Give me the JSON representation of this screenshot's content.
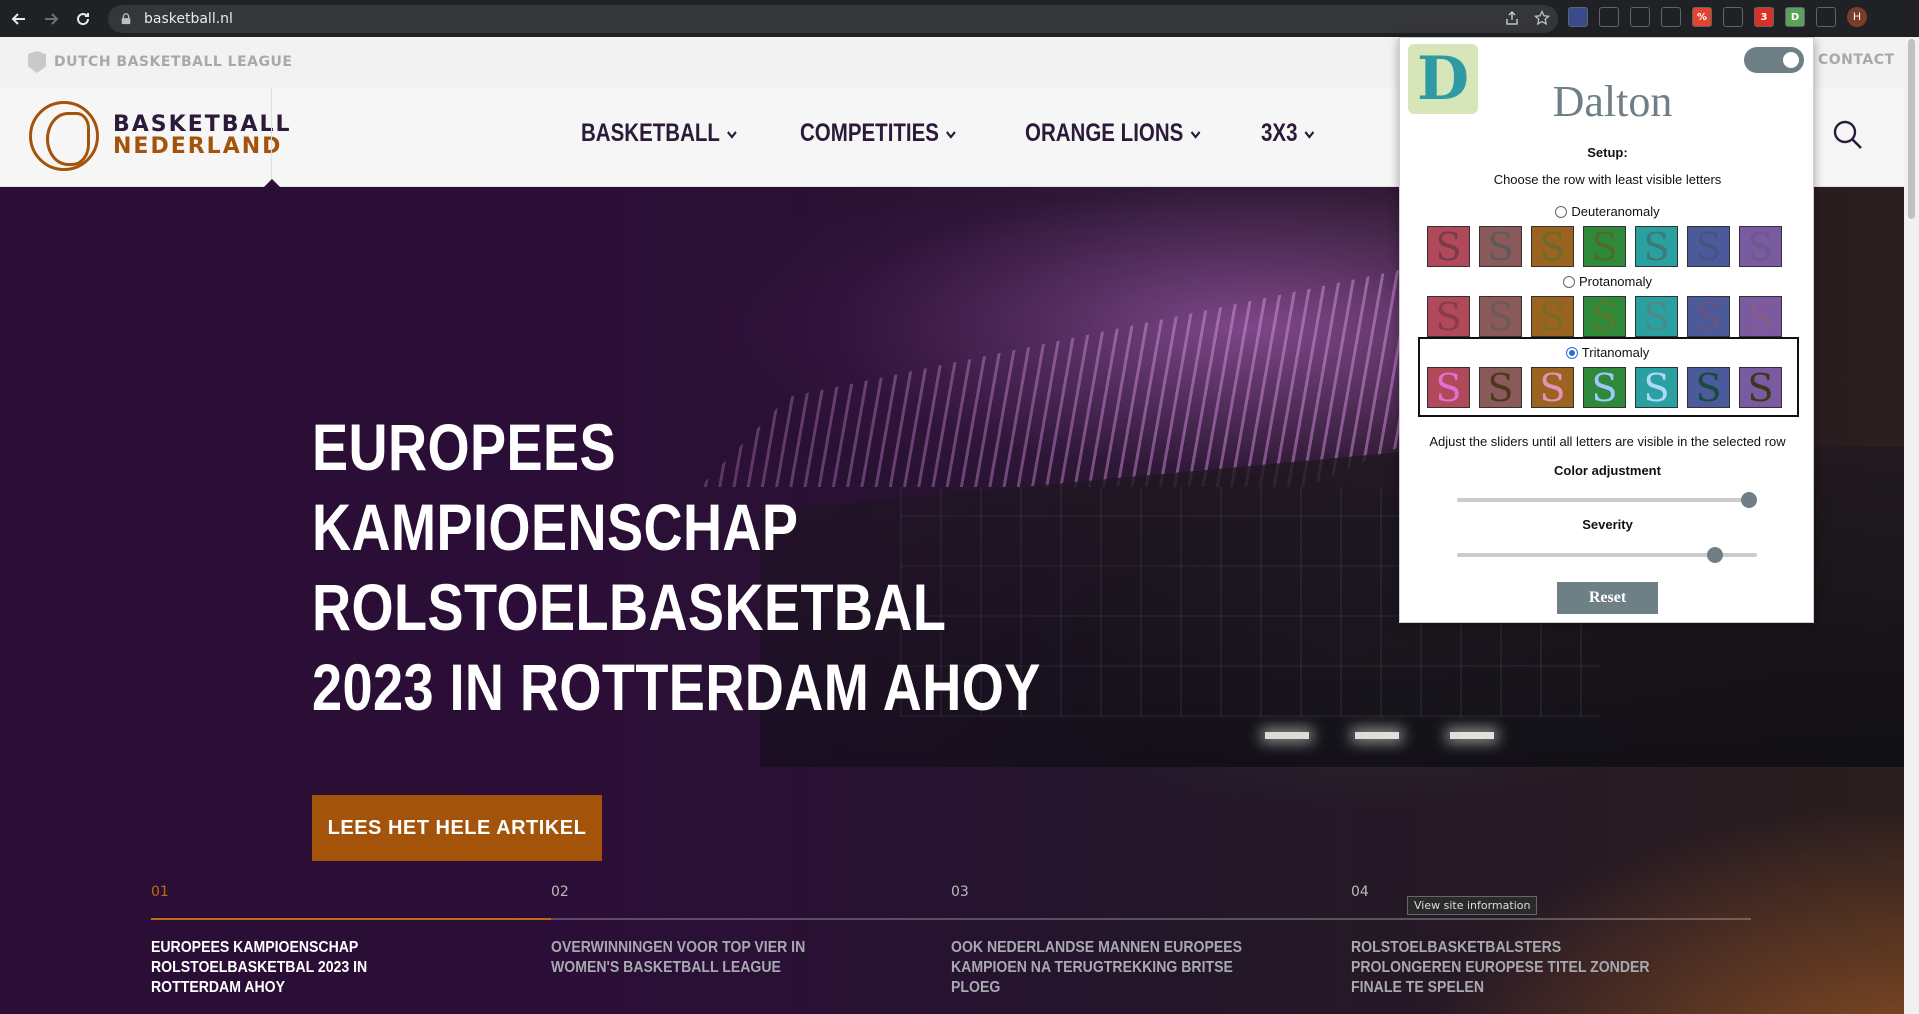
{
  "browser": {
    "url": "basketball.nl",
    "profile_initial": "H",
    "extensions": [
      {
        "name": "pen-extension-icon",
        "color": "#3a4b8c",
        "label": ""
      },
      {
        "name": "bars-extension-icon",
        "color": "#202124",
        "label": ""
      },
      {
        "name": "image-extension-icon",
        "color": "#202124",
        "label": ""
      },
      {
        "name": "v-extension-icon",
        "color": "#202124",
        "label": ""
      },
      {
        "name": "todoist-extension-icon",
        "color": "#e44332",
        "label": "%"
      },
      {
        "name": "camera-extension-icon",
        "color": "#202124",
        "label": ""
      },
      {
        "name": "adblock-extension-icon",
        "color": "#d93025",
        "label": "3"
      },
      {
        "name": "dalton-extension-icon",
        "color": "#5aa25a",
        "label": "D"
      },
      {
        "name": "puzzle-extension-icon",
        "color": "#202124",
        "label": ""
      }
    ]
  },
  "site": {
    "league_label": "DUTCH BASKETBALL LEAGUE",
    "contact_label": "CONTACT",
    "logo_line1": "BASKETBALL",
    "logo_line2": "NEDERLAND",
    "nav": [
      "BASKETBALL",
      "COMPETITIES",
      "ORANGE LIONS",
      "3X3"
    ],
    "headline": [
      "EUROPEES",
      "KAMPIOENSCHAP",
      "ROLSTOELBASKETBAL",
      "2023 IN ROTTERDAM AHOY"
    ],
    "cta_label": "LEES HET HELE ARTIKEL",
    "tooltip": "View site information",
    "slides": [
      {
        "num": "01",
        "title": "EUROPEES KAMPIOENSCHAP ROLSTOELBASKETBAL 2023 IN ROTTERDAM AHOY",
        "active": true
      },
      {
        "num": "02",
        "title": "OVERWINNINGEN VOOR TOP VIER IN WOMEN'S BASKETBALL LEAGUE",
        "active": false
      },
      {
        "num": "03",
        "title": "OOK NEDERLANDSE MANNEN EUROPEES KAMPIOEN NA TERUGTREKKING BRITSE PLOEG",
        "active": false
      },
      {
        "num": "04",
        "title": "ROLSTOELBASKETBALSTERS PROLONGEREN EUROPESE TITEL ZONDER FINALE TE SPELEN",
        "active": false
      }
    ]
  },
  "dalton": {
    "title": "Dalton",
    "logo_letter": "D",
    "enabled": true,
    "setup_label": "Setup:",
    "instruction": "Choose the row with least visible letters",
    "swatch_letter": "S",
    "rows": [
      {
        "label": "Deuteranomaly",
        "selected": false,
        "swatches": [
          [
            "#b04a5a",
            "#7a3a4a"
          ],
          [
            "#8a5a5a",
            "#5e5a58"
          ],
          [
            "#9a6420",
            "#6c6a2a"
          ],
          [
            "#2e8a3a",
            "#4f6a2a"
          ],
          [
            "#2aa0a0",
            "#3a7a78"
          ],
          [
            "#4a5a9a",
            "#4a5282"
          ],
          [
            "#7a5aa0",
            "#6a5a8a"
          ]
        ]
      },
      {
        "label": "Protanomaly",
        "selected": false,
        "swatches": [
          [
            "#b04a5a",
            "#8a3a4a"
          ],
          [
            "#8a5a5a",
            "#6a5a58"
          ],
          [
            "#9a6420",
            "#7a6a2a"
          ],
          [
            "#2e8a3a",
            "#5a7a2a"
          ],
          [
            "#2aa0a0",
            "#4a8a88"
          ],
          [
            "#4a5a9a",
            "#6a5282"
          ],
          [
            "#7a5aa0",
            "#8a5a8a"
          ]
        ]
      },
      {
        "label": "Tritanomaly",
        "selected": true,
        "swatches": [
          [
            "#b04a5a",
            "#e070d0"
          ],
          [
            "#8a5a5a",
            "#4a3a1a"
          ],
          [
            "#9a6420",
            "#e890c0"
          ],
          [
            "#2e8a3a",
            "#a0c8ff"
          ],
          [
            "#2aa0a0",
            "#b0d8ff"
          ],
          [
            "#4a5a9a",
            "#1a4a3a"
          ],
          [
            "#7a5aa0",
            "#3a3a1a"
          ]
        ]
      }
    ],
    "adjust_instruction": "Adjust the sliders until all letters are visible in the selected row",
    "color_adjustment_label": "Color adjustment",
    "color_adjustment_value": 1.0,
    "severity_label": "Severity",
    "severity_value": 0.88,
    "reset_label": "Reset"
  }
}
